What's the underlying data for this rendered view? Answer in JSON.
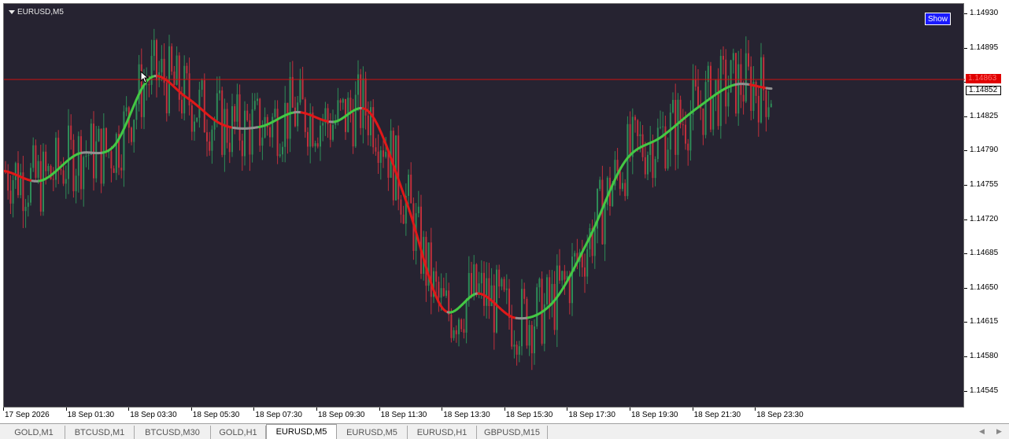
{
  "symbol_label": "EURUSD,M5",
  "show_button": "Show",
  "current_price_red": "1.14863",
  "current_price_white": "1.14852",
  "price_axis": {
    "labels": [
      "1.14930",
      "1.14895",
      "1.14860",
      "1.14825",
      "1.14790",
      "1.14755",
      "1.14720",
      "1.14685",
      "1.14650",
      "1.14615",
      "1.14580",
      "1.14545"
    ],
    "top_price": 1.1493,
    "step": 0.00035
  },
  "time_axis": {
    "labels": [
      "17 Sep 2026",
      "18 Sep 01:30",
      "18 Sep 03:30",
      "18 Sep 05:30",
      "18 Sep 07:30",
      "18 Sep 09:30",
      "18 Sep 11:30",
      "18 Sep 13:30",
      "18 Sep 15:30",
      "18 Sep 17:30",
      "18 Sep 19:30",
      "18 Sep 21:30",
      "18 Sep 23:30"
    ]
  },
  "tabs": [
    {
      "label": "GOLD,M1",
      "active": false
    },
    {
      "label": "BTCUSD,M1",
      "active": false
    },
    {
      "label": "BTCUSD,M30",
      "active": false
    },
    {
      "label": "GOLD,H1",
      "active": false
    },
    {
      "label": "EURUSD,M5",
      "active": true
    },
    {
      "label": "EURUSD,M5",
      "active": false
    },
    {
      "label": "EURUSD,H1",
      "active": false
    },
    {
      "label": "GBPUSD,M15",
      "active": false
    }
  ],
  "colors": {
    "background": "#262331",
    "bull": "#2e8b57",
    "bear": "#c0303c",
    "ma_up": "#44c844",
    "ma_down": "#e01818",
    "ma_flat": "#909090",
    "price_line": "#d01010"
  },
  "icons": {
    "dropdown": "triangle-down-icon",
    "cursor": "mouse-pointer-icon"
  },
  "chart_data": {
    "type": "candlestick",
    "series": [
      {
        "name": "",
        "x": [
          "17 Sep 2026",
          "18 Sep 01:30",
          "18 Sep 03:30",
          "18 Sep 05:30",
          "18 Sep 06:30",
          "18 Sep 07:30",
          "18 Sep 08:30",
          "18 Sep 09:30",
          "18 Sep 10:30",
          "18 Sep 11:30",
          "18 Sep 12:30",
          "18 Sep 13:30",
          "18 Sep 14:30",
          "18 Sep 15:30",
          "18 Sep 16:30",
          "18 Sep 17:30",
          "18 Sep 18:30",
          "18 Sep 19:30",
          "18 Sep 20:30",
          "18 Sep 21:30",
          "18 Sep 22:30",
          "18 Sep 23:30"
        ],
        "ma": [
          1.1477,
          1.1476,
          1.14787,
          1.14795,
          1.14865,
          1.14845,
          1.14817,
          1.14815,
          1.1483,
          1.1482,
          1.1483,
          1.1474,
          1.1463,
          1.14645,
          1.1462,
          1.14635,
          1.147,
          1.1478,
          1.14805,
          1.14835,
          1.14858,
          1.14854
        ]
      }
    ],
    "ylim": [
      1.1453,
      1.14945
    ]
  }
}
